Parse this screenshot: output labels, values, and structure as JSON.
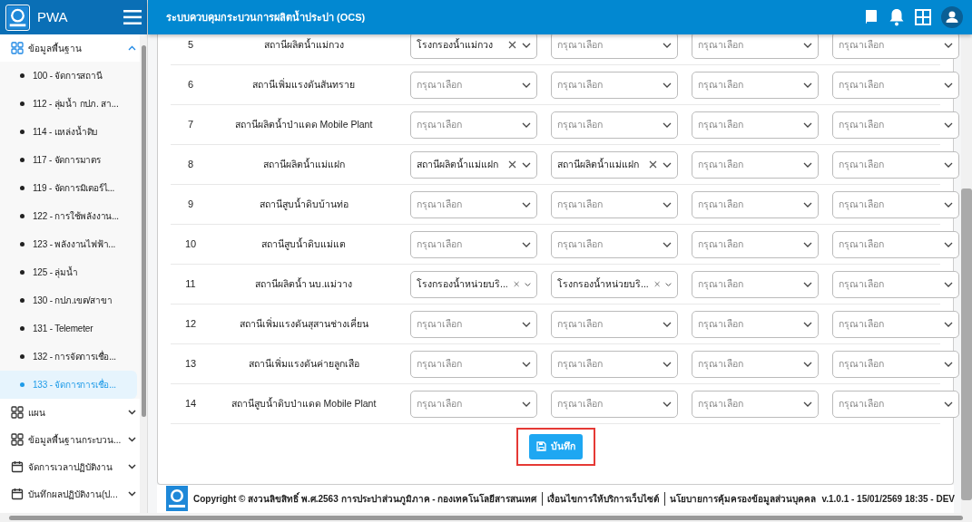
{
  "brand": {
    "name": "PWA"
  },
  "app_title": "ระบบควบคุมกระบวนการผลิตน้ำประปา (OCS)",
  "sidebar": {
    "items": [
      {
        "label": "ข้อมูลพื้นฐาน",
        "kind": "grid",
        "expanded": true,
        "children": [
          {
            "label": "100 - จัดการสถานี",
            "selected": false
          },
          {
            "label": "112 - ลุ่มน้ำ กปภ. สา...",
            "selected": false
          },
          {
            "label": "114 - แหล่งน้ำดิบ",
            "selected": false
          },
          {
            "label": "117 - จัดการมาตร",
            "selected": false
          },
          {
            "label": "119 - จัดการมิเตอร์ไ...",
            "selected": false
          },
          {
            "label": "122 - การใช้พลังงาน...",
            "selected": false
          },
          {
            "label": "123 - พลังงานไฟฟ้า...",
            "selected": false
          },
          {
            "label": "125 - ลุ่มน้ำ",
            "selected": false
          },
          {
            "label": "130 - กปภ.เขต/สาขา",
            "selected": false
          },
          {
            "label": "131 - Telemeter",
            "selected": false
          },
          {
            "label": "132 - การจัดการเชื่อ...",
            "selected": false
          },
          {
            "label": "133 - จัดการการเชื่อ...",
            "selected": true
          }
        ]
      },
      {
        "label": "แผน",
        "kind": "grid",
        "expanded": false
      },
      {
        "label": "ข้อมูลพื้นฐานกระบวน...",
        "kind": "grid",
        "expanded": false
      },
      {
        "label": "จัดการเวลาปฏิบัติงาน",
        "kind": "calendar",
        "expanded": false
      },
      {
        "label": "บันทึกผลปฏิบัติงาน(ป...",
        "kind": "calendar",
        "expanded": false
      }
    ]
  },
  "table": {
    "rows": [
      {
        "no": "5",
        "station": "สถานีผลิตน้ำแม่กวง",
        "selects": [
          {
            "value": "โรงกรองน้ำแม่กวง"
          },
          {
            "placeholder": "กรุณาเลือก"
          },
          {
            "placeholder": "กรุณาเลือก"
          },
          {
            "placeholder": "กรุณาเลือก"
          }
        ]
      },
      {
        "no": "6",
        "station": "สถานีเพิ่มแรงดันสันทราย",
        "selects": [
          {
            "placeholder": "กรุณาเลือก"
          },
          {
            "placeholder": "กรุณาเลือก"
          },
          {
            "placeholder": "กรุณาเลือก"
          },
          {
            "placeholder": "กรุณาเลือก"
          }
        ]
      },
      {
        "no": "7",
        "station": "สถานีผลิตน้ำป่าแดด Mobile Plant",
        "selects": [
          {
            "placeholder": "กรุณาเลือก"
          },
          {
            "placeholder": "กรุณาเลือก"
          },
          {
            "placeholder": "กรุณาเลือก"
          },
          {
            "placeholder": "กรุณาเลือก"
          }
        ]
      },
      {
        "no": "8",
        "station": "สถานีผลิตน้ำแม่แฝก",
        "selects": [
          {
            "value": "สถานีผลิตน้ำแม่แฝก"
          },
          {
            "value": "สถานีผลิตน้ำแม่แฝก"
          },
          {
            "placeholder": "กรุณาเลือก"
          },
          {
            "placeholder": "กรุณาเลือก"
          }
        ]
      },
      {
        "no": "9",
        "station": "สถานีสูบน้ำดิบบ้านท่อ",
        "selects": [
          {
            "placeholder": "กรุณาเลือก"
          },
          {
            "placeholder": "กรุณาเลือก"
          },
          {
            "placeholder": "กรุณาเลือก"
          },
          {
            "placeholder": "กรุณาเลือก"
          }
        ]
      },
      {
        "no": "10",
        "station": "สถานีสูบน้ำดิบแม่แต",
        "selects": [
          {
            "placeholder": "กรุณาเลือก"
          },
          {
            "placeholder": "กรุณาเลือก"
          },
          {
            "placeholder": "กรุณาเลือก"
          },
          {
            "placeholder": "กรุณาเลือก"
          }
        ]
      },
      {
        "no": "11",
        "station": "สถานีผลิตน้ำ นบ.แม่วาง",
        "selects": [
          {
            "value": "โรงกรองน้ำหน่วยบริ..."
          },
          {
            "value": "โรงกรองน้ำหน่วยบริ..."
          },
          {
            "placeholder": "กรุณาเลือก"
          },
          {
            "placeholder": "กรุณาเลือก"
          }
        ]
      },
      {
        "no": "12",
        "station": "สถานีเพิ่มแรงดันสุสานช่างเคี่ยน",
        "selects": [
          {
            "placeholder": "กรุณาเลือก"
          },
          {
            "placeholder": "กรุณาเลือก"
          },
          {
            "placeholder": "กรุณาเลือก"
          },
          {
            "placeholder": "กรุณาเลือก"
          }
        ]
      },
      {
        "no": "13",
        "station": "สถานีเพิ่มแรงดันค่ายลูกเสือ",
        "selects": [
          {
            "placeholder": "กรุณาเลือก"
          },
          {
            "placeholder": "กรุณาเลือก"
          },
          {
            "placeholder": "กรุณาเลือก"
          },
          {
            "placeholder": "กรุณาเลือก"
          }
        ]
      },
      {
        "no": "14",
        "station": "สถานีสูบน้ำดิบป่าแดด Mobile Plant",
        "selects": [
          {
            "placeholder": "กรุณาเลือก"
          },
          {
            "placeholder": "กรุณาเลือก"
          },
          {
            "placeholder": "กรุณาเลือก"
          },
          {
            "placeholder": "กรุณาเลือก"
          }
        ]
      }
    ]
  },
  "save_button": {
    "label": "บันทึก",
    "highlighted": true
  },
  "footer": {
    "copyright": "Copyright © สงวนลิขสิทธิ์ พ.ศ.2563 การประปาส่วนภูมิภาค - กองเทคโนโลยีสารสนเทศ",
    "links": [
      "เงื่อนไขการให้บริการเว็บไซต์",
      "นโยบายการคุ้มครองข้อมูลส่วนบุคคล"
    ],
    "version": "v.1.0.1 - 15/01/2569 18:35 - DEV"
  }
}
